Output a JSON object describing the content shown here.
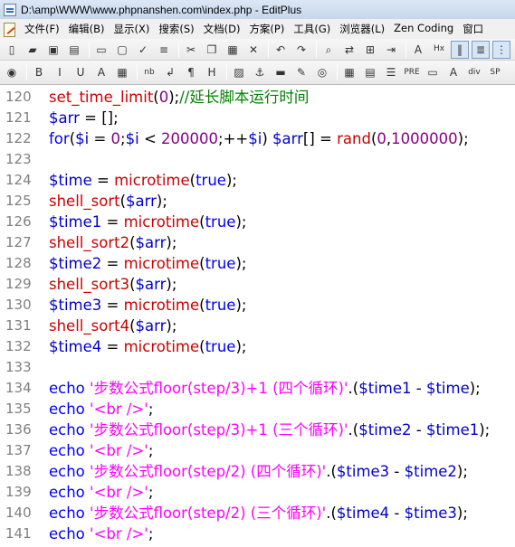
{
  "window": {
    "title": "D:\\amp\\WWW\\www.phpnanshen.com\\index.php - EditPlus"
  },
  "menu": [
    "文件(F)",
    "编辑(B)",
    "显示(X)",
    "搜索(S)",
    "文档(D)",
    "方案(P)",
    "工具(G)",
    "浏览器(L)",
    "Zen Coding",
    "窗口"
  ],
  "toolbar1": [
    {
      "name": "new-file-icon",
      "glyph": "▯"
    },
    {
      "name": "open-folder-icon",
      "glyph": "▰"
    },
    {
      "name": "save-icon",
      "glyph": "▣"
    },
    {
      "name": "save-all-icon",
      "glyph": "▤"
    },
    {
      "sep": true
    },
    {
      "name": "print-icon",
      "glyph": "▭"
    },
    {
      "name": "print-preview-icon",
      "glyph": "▢"
    },
    {
      "name": "spell-check-icon",
      "glyph": "✓"
    },
    {
      "name": "properties-icon",
      "glyph": "≡"
    },
    {
      "sep": true
    },
    {
      "name": "cut-icon",
      "glyph": "✂"
    },
    {
      "name": "copy-icon",
      "glyph": "❐"
    },
    {
      "name": "paste-icon",
      "glyph": "▦"
    },
    {
      "name": "delete-icon",
      "glyph": "✕"
    },
    {
      "sep": true
    },
    {
      "name": "undo-icon",
      "glyph": "↶"
    },
    {
      "name": "redo-icon",
      "glyph": "↷"
    },
    {
      "sep": true
    },
    {
      "name": "find-icon",
      "glyph": "⌕"
    },
    {
      "name": "replace-icon",
      "glyph": "⇄"
    },
    {
      "name": "find-in-files-icon",
      "glyph": "⊞"
    },
    {
      "name": "indent-icon",
      "glyph": "⇥"
    },
    {
      "sep": true
    },
    {
      "name": "font-icon",
      "glyph": "A"
    },
    {
      "name": "hex-icon",
      "glyph": "Hx"
    },
    {
      "name": "word-wrap-icon",
      "glyph": "‖",
      "pressed": true
    },
    {
      "name": "ruler-icon",
      "glyph": "≣",
      "pressed": true
    },
    {
      "name": "line-number-icon",
      "glyph": "⋮",
      "pressed": true
    },
    {
      "name": "check-icon",
      "glyph": "✔"
    }
  ],
  "toolbar2": [
    {
      "name": "browser-icon",
      "glyph": "◉"
    },
    {
      "sep": true
    },
    {
      "name": "bold-icon",
      "glyph": "B"
    },
    {
      "name": "italic-icon",
      "glyph": "I"
    },
    {
      "name": "underline-icon",
      "glyph": "U"
    },
    {
      "name": "font-color-icon",
      "glyph": "A"
    },
    {
      "name": "color-palette-icon",
      "glyph": "▦"
    },
    {
      "sep": true
    },
    {
      "name": "nbsp-icon",
      "glyph": "nb"
    },
    {
      "name": "line-break-icon",
      "glyph": "↲"
    },
    {
      "name": "paragraph-icon",
      "glyph": "¶"
    },
    {
      "name": "heading-icon",
      "glyph": "H"
    },
    {
      "sep": true
    },
    {
      "name": "image-icon",
      "glyph": "▨"
    },
    {
      "name": "anchor-icon",
      "glyph": "⚓"
    },
    {
      "name": "link-icon",
      "glyph": "▬"
    },
    {
      "name": "edit-icon",
      "glyph": "✎"
    },
    {
      "name": "target-icon",
      "glyph": "◎"
    },
    {
      "sep": true
    },
    {
      "name": "table-icon",
      "glyph": "▦"
    },
    {
      "name": "form-icon",
      "glyph": "▤"
    },
    {
      "name": "list-icon",
      "glyph": "☰"
    },
    {
      "name": "pre-icon",
      "glyph": "PRE"
    },
    {
      "name": "hr-icon",
      "glyph": "▭"
    },
    {
      "name": "comment-icon",
      "glyph": "A"
    },
    {
      "name": "div-icon",
      "glyph": "div"
    },
    {
      "name": "span-icon",
      "glyph": "SP"
    }
  ],
  "code_lines": [
    {
      "n": "120",
      "tokens": [
        [
          "fn",
          "set_time_limit"
        ],
        [
          "pn",
          "("
        ],
        [
          "num",
          "0"
        ],
        [
          "pn",
          ");"
        ],
        [
          "cm",
          "//延长脚本运行时间"
        ]
      ]
    },
    {
      "n": "121",
      "tokens": [
        [
          "var",
          "$arr"
        ],
        [
          "pn",
          " = [];"
        ]
      ]
    },
    {
      "n": "122",
      "tokens": [
        [
          "kw",
          "for"
        ],
        [
          "pn",
          "("
        ],
        [
          "var",
          "$i"
        ],
        [
          "pn",
          " = "
        ],
        [
          "num",
          "0"
        ],
        [
          "pn",
          ";"
        ],
        [
          "var",
          "$i"
        ],
        [
          "pn",
          " < "
        ],
        [
          "num",
          "200000"
        ],
        [
          "pn",
          ";++"
        ],
        [
          "var",
          "$i"
        ],
        [
          "pn",
          ") "
        ],
        [
          "var",
          "$arr"
        ],
        [
          "pn",
          "[] = "
        ],
        [
          "fn",
          "rand"
        ],
        [
          "pn",
          "("
        ],
        [
          "num",
          "0"
        ],
        [
          "pn",
          ","
        ],
        [
          "num",
          "1000000"
        ],
        [
          "pn",
          ");"
        ]
      ]
    },
    {
      "n": "123",
      "tokens": []
    },
    {
      "n": "124",
      "tokens": [
        [
          "var",
          "$time"
        ],
        [
          "pn",
          " = "
        ],
        [
          "fn",
          "microtime"
        ],
        [
          "pn",
          "("
        ],
        [
          "lit",
          "true"
        ],
        [
          "pn",
          ");"
        ]
      ]
    },
    {
      "n": "125",
      "tokens": [
        [
          "fn",
          "shell_sort"
        ],
        [
          "pn",
          "("
        ],
        [
          "var",
          "$arr"
        ],
        [
          "pn",
          ");"
        ]
      ]
    },
    {
      "n": "126",
      "tokens": [
        [
          "var",
          "$time1"
        ],
        [
          "pn",
          " = "
        ],
        [
          "fn",
          "microtime"
        ],
        [
          "pn",
          "("
        ],
        [
          "lit",
          "true"
        ],
        [
          "pn",
          ");"
        ]
      ]
    },
    {
      "n": "127",
      "tokens": [
        [
          "fn",
          "shell_sort2"
        ],
        [
          "pn",
          "("
        ],
        [
          "var",
          "$arr"
        ],
        [
          "pn",
          ");"
        ]
      ]
    },
    {
      "n": "128",
      "tokens": [
        [
          "var",
          "$time2"
        ],
        [
          "pn",
          " = "
        ],
        [
          "fn",
          "microtime"
        ],
        [
          "pn",
          "("
        ],
        [
          "lit",
          "true"
        ],
        [
          "pn",
          ");"
        ]
      ]
    },
    {
      "n": "129",
      "tokens": [
        [
          "fn",
          "shell_sort3"
        ],
        [
          "pn",
          "("
        ],
        [
          "var",
          "$arr"
        ],
        [
          "pn",
          ");"
        ]
      ]
    },
    {
      "n": "130",
      "tokens": [
        [
          "var",
          "$time3"
        ],
        [
          "pn",
          " = "
        ],
        [
          "fn",
          "microtime"
        ],
        [
          "pn",
          "("
        ],
        [
          "lit",
          "true"
        ],
        [
          "pn",
          ");"
        ]
      ]
    },
    {
      "n": "131",
      "tokens": [
        [
          "fn",
          "shell_sort4"
        ],
        [
          "pn",
          "("
        ],
        [
          "var",
          "$arr"
        ],
        [
          "pn",
          ");"
        ]
      ]
    },
    {
      "n": "132",
      "tokens": [
        [
          "var",
          "$time4"
        ],
        [
          "pn",
          " = "
        ],
        [
          "fn",
          "microtime"
        ],
        [
          "pn",
          "("
        ],
        [
          "lit",
          "true"
        ],
        [
          "pn",
          ");"
        ]
      ]
    },
    {
      "n": "133",
      "tokens": []
    },
    {
      "n": "134",
      "tokens": [
        [
          "kw",
          "echo "
        ],
        [
          "str",
          "'步数公式floor(step/3)+1 (四个循环)'"
        ],
        [
          "pn",
          ".("
        ],
        [
          "var",
          "$time1"
        ],
        [
          "pn",
          " - "
        ],
        [
          "var",
          "$time"
        ],
        [
          "pn",
          ");"
        ]
      ]
    },
    {
      "n": "135",
      "tokens": [
        [
          "kw",
          "echo "
        ],
        [
          "str",
          "'<br />'"
        ],
        [
          "pn",
          ";"
        ]
      ]
    },
    {
      "n": "136",
      "tokens": [
        [
          "kw",
          "echo "
        ],
        [
          "str",
          "'步数公式floor(step/3)+1 (三个循环)'"
        ],
        [
          "pn",
          ".("
        ],
        [
          "var",
          "$time2"
        ],
        [
          "pn",
          " - "
        ],
        [
          "var",
          "$time1"
        ],
        [
          "pn",
          ");"
        ]
      ]
    },
    {
      "n": "137",
      "tokens": [
        [
          "kw",
          "echo "
        ],
        [
          "str",
          "'<br />'"
        ],
        [
          "pn",
          ";"
        ]
      ]
    },
    {
      "n": "138",
      "tokens": [
        [
          "kw",
          "echo "
        ],
        [
          "str",
          "'步数公式floor(step/2) (四个循环)'"
        ],
        [
          "pn",
          ".("
        ],
        [
          "var",
          "$time3"
        ],
        [
          "pn",
          " - "
        ],
        [
          "var",
          "$time2"
        ],
        [
          "pn",
          ");"
        ]
      ]
    },
    {
      "n": "139",
      "tokens": [
        [
          "kw",
          "echo "
        ],
        [
          "str",
          "'<br />'"
        ],
        [
          "pn",
          ";"
        ]
      ]
    },
    {
      "n": "140",
      "tokens": [
        [
          "kw",
          "echo "
        ],
        [
          "str",
          "'步数公式floor(step/2) (三个循环)'"
        ],
        [
          "pn",
          ".("
        ],
        [
          "var",
          "$time4"
        ],
        [
          "pn",
          " - "
        ],
        [
          "var",
          "$time3"
        ],
        [
          "pn",
          ");"
        ]
      ]
    },
    {
      "n": "141",
      "tokens": [
        [
          "kw",
          "echo "
        ],
        [
          "str",
          "'<br />'"
        ],
        [
          "pn",
          ";"
        ]
      ]
    }
  ]
}
